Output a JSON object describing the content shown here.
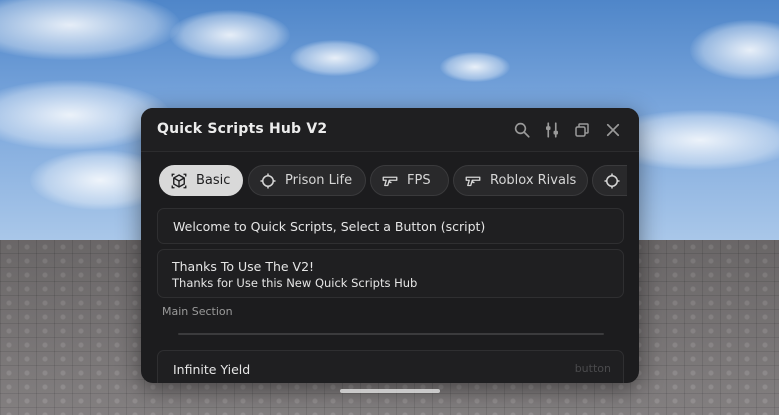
{
  "window": {
    "title": "Quick Scripts Hub V2"
  },
  "titlebar_icons": [
    "search-icon",
    "sliders-icon",
    "copy-icon",
    "close-icon"
  ],
  "tabs": [
    {
      "label": "Basic",
      "icon": "cube-icon",
      "active": true
    },
    {
      "label": "Prison Life",
      "icon": "crosshair-icon",
      "active": false
    },
    {
      "label": "FPS",
      "icon": "gun-icon",
      "active": false
    },
    {
      "label": "Roblox Rivals",
      "icon": "gun-icon",
      "active": false
    },
    {
      "label": "",
      "icon": "crosshair-icon",
      "active": false
    }
  ],
  "content": {
    "welcome": "Welcome to Quick Scripts, Select a Button (script)",
    "thanks_title": "Thanks To Use The V2!",
    "thanks_body": "Thanks for Use this New Quick Scripts Hub",
    "section_label": "Main Section",
    "button_label": "Infinite Yield",
    "button_hint": "button"
  },
  "colors": {
    "window_bg": "#1c1c1e",
    "active_tab_bg": "#d9d9d9",
    "text": "#e6e6e6"
  }
}
